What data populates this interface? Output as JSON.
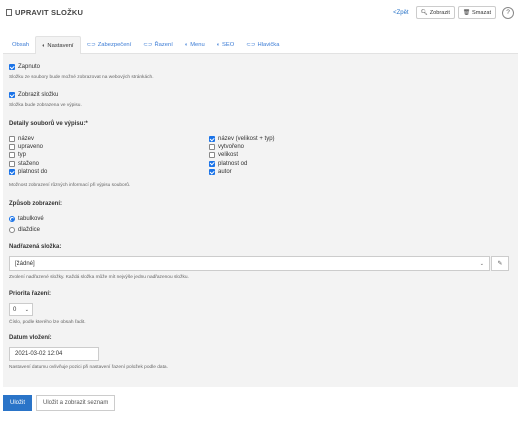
{
  "header": {
    "title": "UPRAVIT SLOŽKU",
    "back_label": "<Zpět",
    "show_label": "Zobrazit",
    "delete_label": "Smazat",
    "help_label": "?"
  },
  "tabs": [
    {
      "label": "Obsah",
      "icon": ""
    },
    {
      "label": "Nastavení",
      "icon": "◐"
    },
    {
      "label": "Zabezpečení",
      "icon": "⊂⊃"
    },
    {
      "label": "Řazení",
      "icon": "⊂⊃"
    },
    {
      "label": "Menu",
      "icon": "◐"
    },
    {
      "label": "SEO",
      "icon": "◐"
    },
    {
      "label": "Hlavička",
      "icon": "⊂⊃"
    }
  ],
  "settings": {
    "zapnuto": {
      "label": "Zapnuto",
      "checked": true,
      "help": "Složku ze soubory bude možné zobrazovat na webových stránkách."
    },
    "zobrazit": {
      "label": "Zobrazit složku",
      "checked": true,
      "help": "Složka bude zobrazena ve výpisu."
    },
    "details": {
      "label": "Detaily souborů ve výpisu:*",
      "left": [
        {
          "label": "název",
          "checked": false
        },
        {
          "label": "upraveno",
          "checked": false
        },
        {
          "label": "typ",
          "checked": false
        },
        {
          "label": "staženo",
          "checked": false
        },
        {
          "label": "platnost do",
          "checked": true
        }
      ],
      "right": [
        {
          "label": "název (velikost + typ)",
          "checked": true
        },
        {
          "label": "vytvořeno",
          "checked": false
        },
        {
          "label": "velikost",
          "checked": false
        },
        {
          "label": "platnost od",
          "checked": true
        },
        {
          "label": "autor",
          "checked": true
        }
      ],
      "help": "Možnost zobrazení různých informací při výpisu souborů."
    },
    "zpusob": {
      "label": "Způsob zobrazení:",
      "options": [
        {
          "label": "tabulkové",
          "checked": true
        },
        {
          "label": "dlaždice",
          "checked": false
        }
      ]
    },
    "nadrazena": {
      "label": "Nadřazená složka:",
      "value": "[žádné]",
      "help": "Zvolení nadřazené složky. Každá složka může mít nejvýše jednu nadřazenou složku."
    },
    "priorita": {
      "label": "Priorita řazení:",
      "value": "0",
      "help": "Číslo, podle kterého lze obsah řadit."
    },
    "datum": {
      "label": "Datum vložení:",
      "value": "2021-03-02 12:04",
      "help": "Nastavení datumu ovlivňuje pozici při nastavení řazení položek podle data."
    }
  },
  "footer": {
    "save_label": "Uložit",
    "save_list_label": "Uložit a zobrazit seznam"
  },
  "colors": {
    "accent": "#2a74c8",
    "checkbox": "#1a73e8",
    "panel": "#f3f3f3"
  }
}
